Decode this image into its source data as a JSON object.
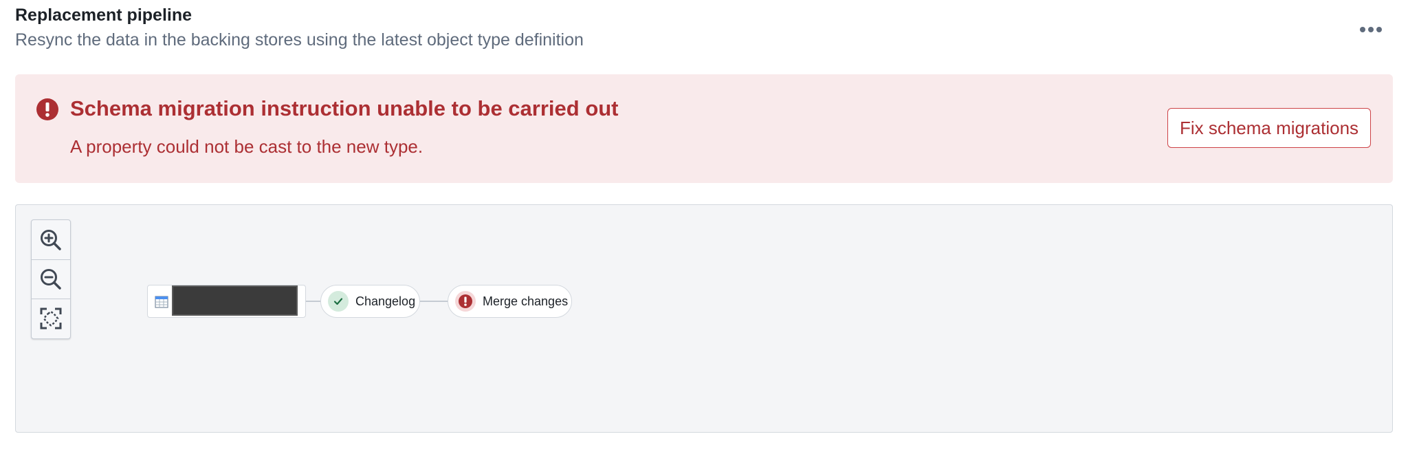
{
  "header": {
    "title": "Replacement pipeline",
    "subtitle": "Resync the data in the backing stores using the latest object type definition",
    "more_icon": "more-horizontal-icon"
  },
  "error_callout": {
    "icon": "error-icon",
    "title": "Schema migration instruction unable to be carried out",
    "message": "A property could not be cast to the new type.",
    "action_label": "Fix schema migrations",
    "colors": {
      "background": "#f9eaeb",
      "text": "#ac2f33",
      "border": "#cd4246"
    }
  },
  "graph": {
    "zoom_controls": [
      {
        "icon": "zoom-in-icon"
      },
      {
        "icon": "zoom-out-icon"
      },
      {
        "icon": "zoom-to-fit-icon"
      }
    ],
    "nodes": [
      {
        "type": "dataset",
        "icon": "table-icon",
        "label": "",
        "redacted": true
      },
      {
        "type": "step",
        "label": "Changelog",
        "status": "success",
        "status_icon": "tick-icon"
      },
      {
        "type": "step",
        "label": "Merge changes",
        "status": "error",
        "status_icon": "error-icon"
      }
    ]
  }
}
